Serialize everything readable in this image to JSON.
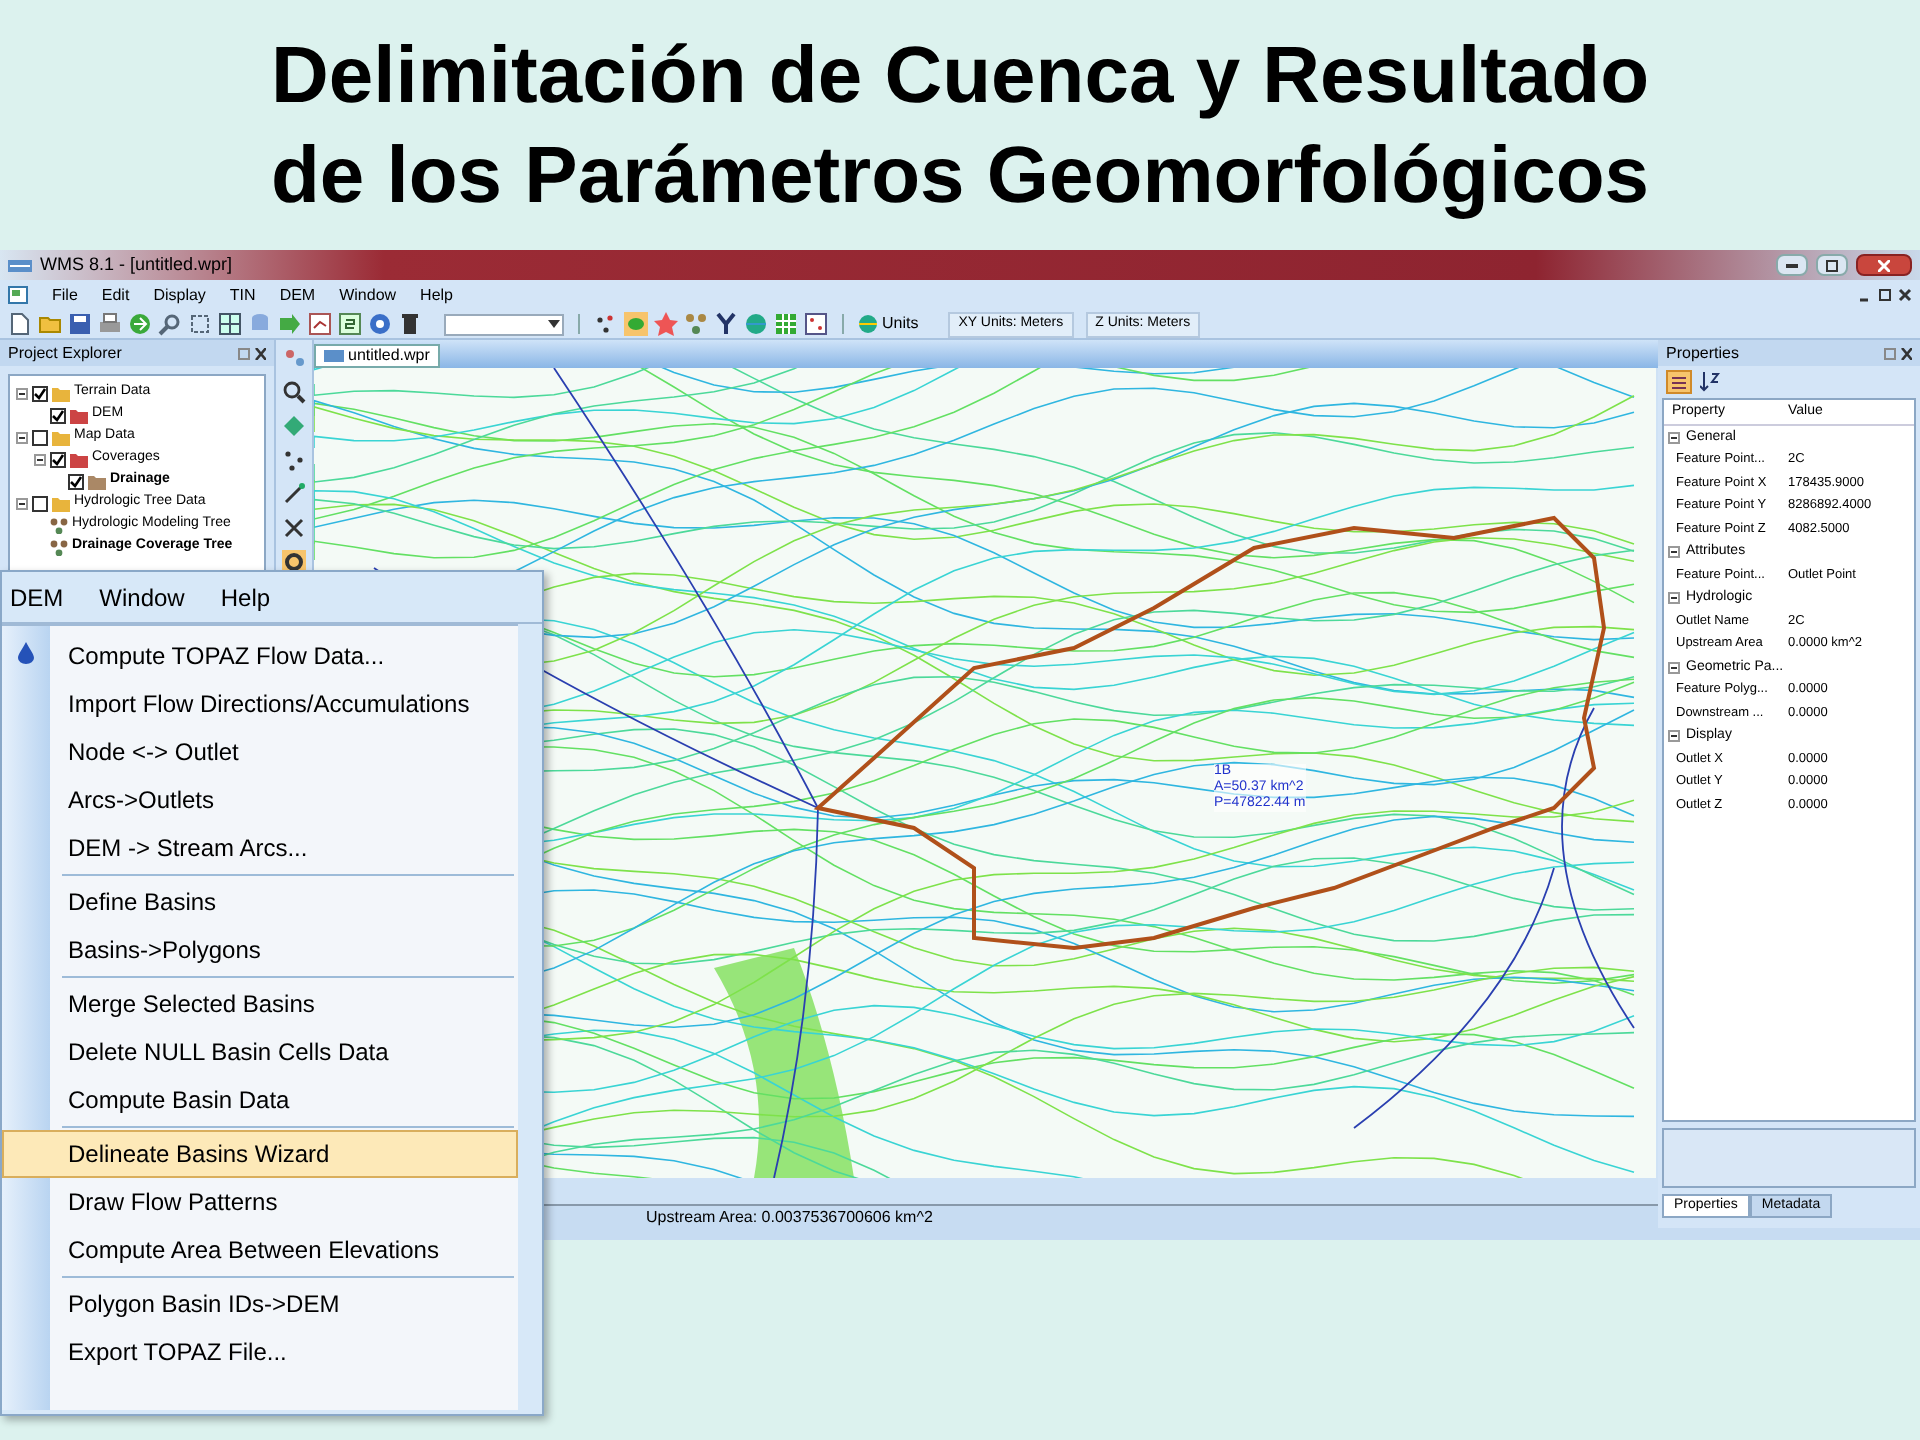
{
  "slide_title": [
    "Delimitación de Cuenca y Resultado",
    "de los Parámetros Geomorfológicos"
  ],
  "window": {
    "title": "WMS 8.1 - [untitled.wpr]"
  },
  "menu_bar": [
    "File",
    "Edit",
    "Display",
    "TIN",
    "DEM",
    "Window",
    "Help"
  ],
  "toolbar": {
    "units_button": "Units",
    "xy_units": "XY Units: Meters",
    "z_units": "Z Units: Meters"
  },
  "project_explorer": {
    "title": "Project Explorer",
    "tree": [
      {
        "label": "Terrain Data",
        "kind": "layer",
        "checked": true,
        "bold": false,
        "children": [
          {
            "label": "DEM",
            "kind": "layer",
            "checked": true,
            "bold": false
          }
        ]
      },
      {
        "label": "Map Data",
        "kind": "layer",
        "checked": false,
        "bold": false,
        "children": [
          {
            "label": "Coverages",
            "kind": "layer",
            "checked": true,
            "bold": false,
            "children": [
              {
                "label": "Drainage",
                "kind": "layer",
                "checked": true,
                "bold": true
              }
            ]
          }
        ]
      },
      {
        "label": "Hydrologic Tree Data",
        "kind": "layer",
        "checked": false,
        "bold": false,
        "children": [
          {
            "label": "Hydrologic Modeling Tree",
            "kind": "tree",
            "bold": false
          },
          {
            "label": "Drainage Coverage Tree",
            "kind": "tree",
            "bold": true
          }
        ]
      }
    ]
  },
  "document_tab": "untitled.wpr",
  "map": {
    "labels": [
      "1B",
      "A=50.37 km^2",
      "P=47822.44 m"
    ]
  },
  "properties": {
    "title": "Properties",
    "columns": [
      "Property",
      "Value"
    ],
    "groups": [
      {
        "name": "General",
        "expanded": true,
        "rows": [
          {
            "property": "Feature Point...",
            "value": "2C"
          },
          {
            "property": "Feature Point X",
            "value": "178435.9000"
          },
          {
            "property": "Feature Point Y",
            "value": "8286892.4000"
          },
          {
            "property": "Feature Point Z",
            "value": "4082.5000"
          }
        ]
      },
      {
        "name": "Attributes",
        "expanded": true,
        "rows": [
          {
            "property": "Feature Point...",
            "value": "Outlet Point"
          }
        ]
      },
      {
        "name": "Hydrologic",
        "expanded": true,
        "rows": [
          {
            "property": "Outlet Name",
            "value": "2C"
          },
          {
            "property": "Upstream Area",
            "value": "0.0000 km^2"
          }
        ]
      },
      {
        "name": "Geometric Pa...",
        "expanded": true,
        "rows": [
          {
            "property": "Feature Polyg...",
            "value": "0.0000"
          },
          {
            "property": "Downstream ...",
            "value": "0.0000"
          }
        ]
      },
      {
        "name": "Display",
        "expanded": true,
        "rows": [
          {
            "property": "Outlet X",
            "value": "0.0000"
          },
          {
            "property": "Outlet Y",
            "value": "0.0000"
          },
          {
            "property": "Outlet Z",
            "value": "0.0000"
          }
        ]
      }
    ],
    "tabs": [
      {
        "label": "Properties",
        "selected": true
      },
      {
        "label": "Metadata",
        "selected": false
      }
    ]
  },
  "status_bar": "Upstream Area: 0.0037536700606 km^2",
  "dem_menu": {
    "menu_bar": [
      "DEM",
      "Window",
      "Help"
    ],
    "groups": [
      [
        {
          "label": "Compute TOPAZ Flow Data...",
          "selected": false
        },
        {
          "label": "Import Flow Directions/Accumulations",
          "selected": false
        },
        {
          "label": "Node <-> Outlet",
          "selected": false
        },
        {
          "label": "Arcs->Outlets",
          "selected": false
        },
        {
          "label": "DEM -> Stream Arcs...",
          "selected": false
        }
      ],
      [
        {
          "label": "Define Basins",
          "selected": false
        },
        {
          "label": "Basins->Polygons",
          "selected": false
        }
      ],
      [
        {
          "label": "Merge Selected Basins",
          "selected": false
        },
        {
          "label": "Delete NULL Basin Cells Data",
          "selected": false
        },
        {
          "label": "Compute Basin Data",
          "selected": false
        }
      ],
      [
        {
          "label": "Delineate Basins Wizard",
          "selected": true
        },
        {
          "label": "Draw Flow Patterns",
          "selected": false
        },
        {
          "label": "Compute Area Between Elevations",
          "selected": false
        }
      ],
      [
        {
          "label": "Polygon Basin IDs->DEM",
          "selected": false
        },
        {
          "label": "Export TOPAZ File...",
          "selected": false
        }
      ]
    ]
  }
}
